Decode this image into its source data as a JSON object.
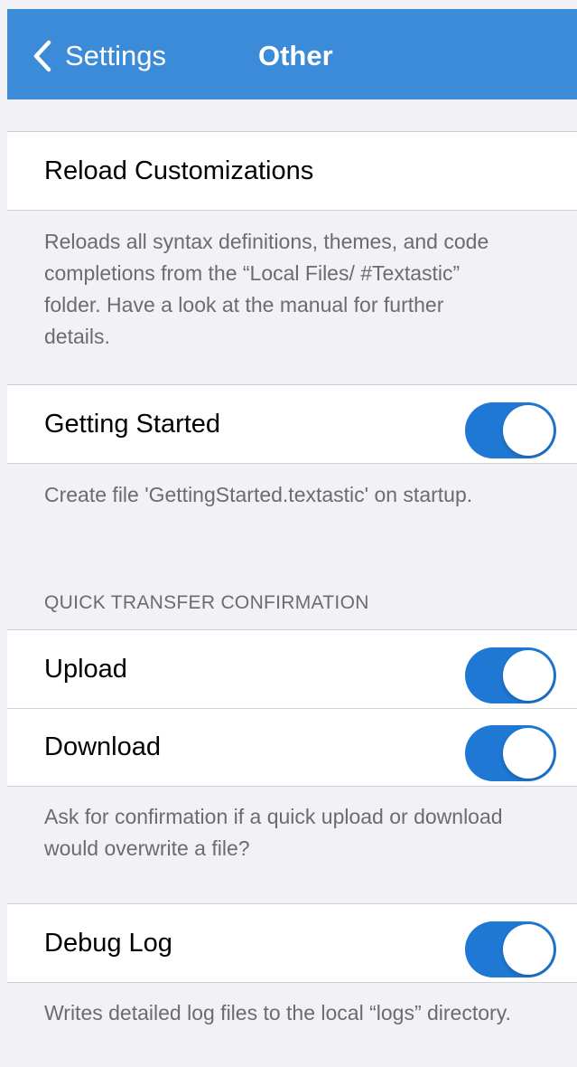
{
  "navbar": {
    "back_label": "Settings",
    "title": "Other",
    "background": "#3c8bd9",
    "back_icon": "chevron-left-icon"
  },
  "reload": {
    "label": "Reload Customizations",
    "footer": "Reloads all syntax definitions, themes, and code completions from the “Local Files/ #Textastic” folder. Have a look at the manual for further details."
  },
  "getting_started": {
    "label": "Getting Started",
    "enabled": true,
    "footer": "Create file 'GettingStarted.textastic' on startup."
  },
  "quick_transfer": {
    "header": "QUICK TRANSFER CONFIRMATION",
    "upload_label": "Upload",
    "upload_enabled": true,
    "download_label": "Download",
    "download_enabled": true,
    "footer": "Ask for confirmation if a quick upload or download would overwrite a file?"
  },
  "debug_log": {
    "label": "Debug Log",
    "enabled": true,
    "footer": "Writes detailed log files to the local “logs” directory."
  },
  "colors": {
    "toggle_on": "#1e78d4",
    "background": "#f2f1f6",
    "footer_text": "#6b6b70"
  }
}
